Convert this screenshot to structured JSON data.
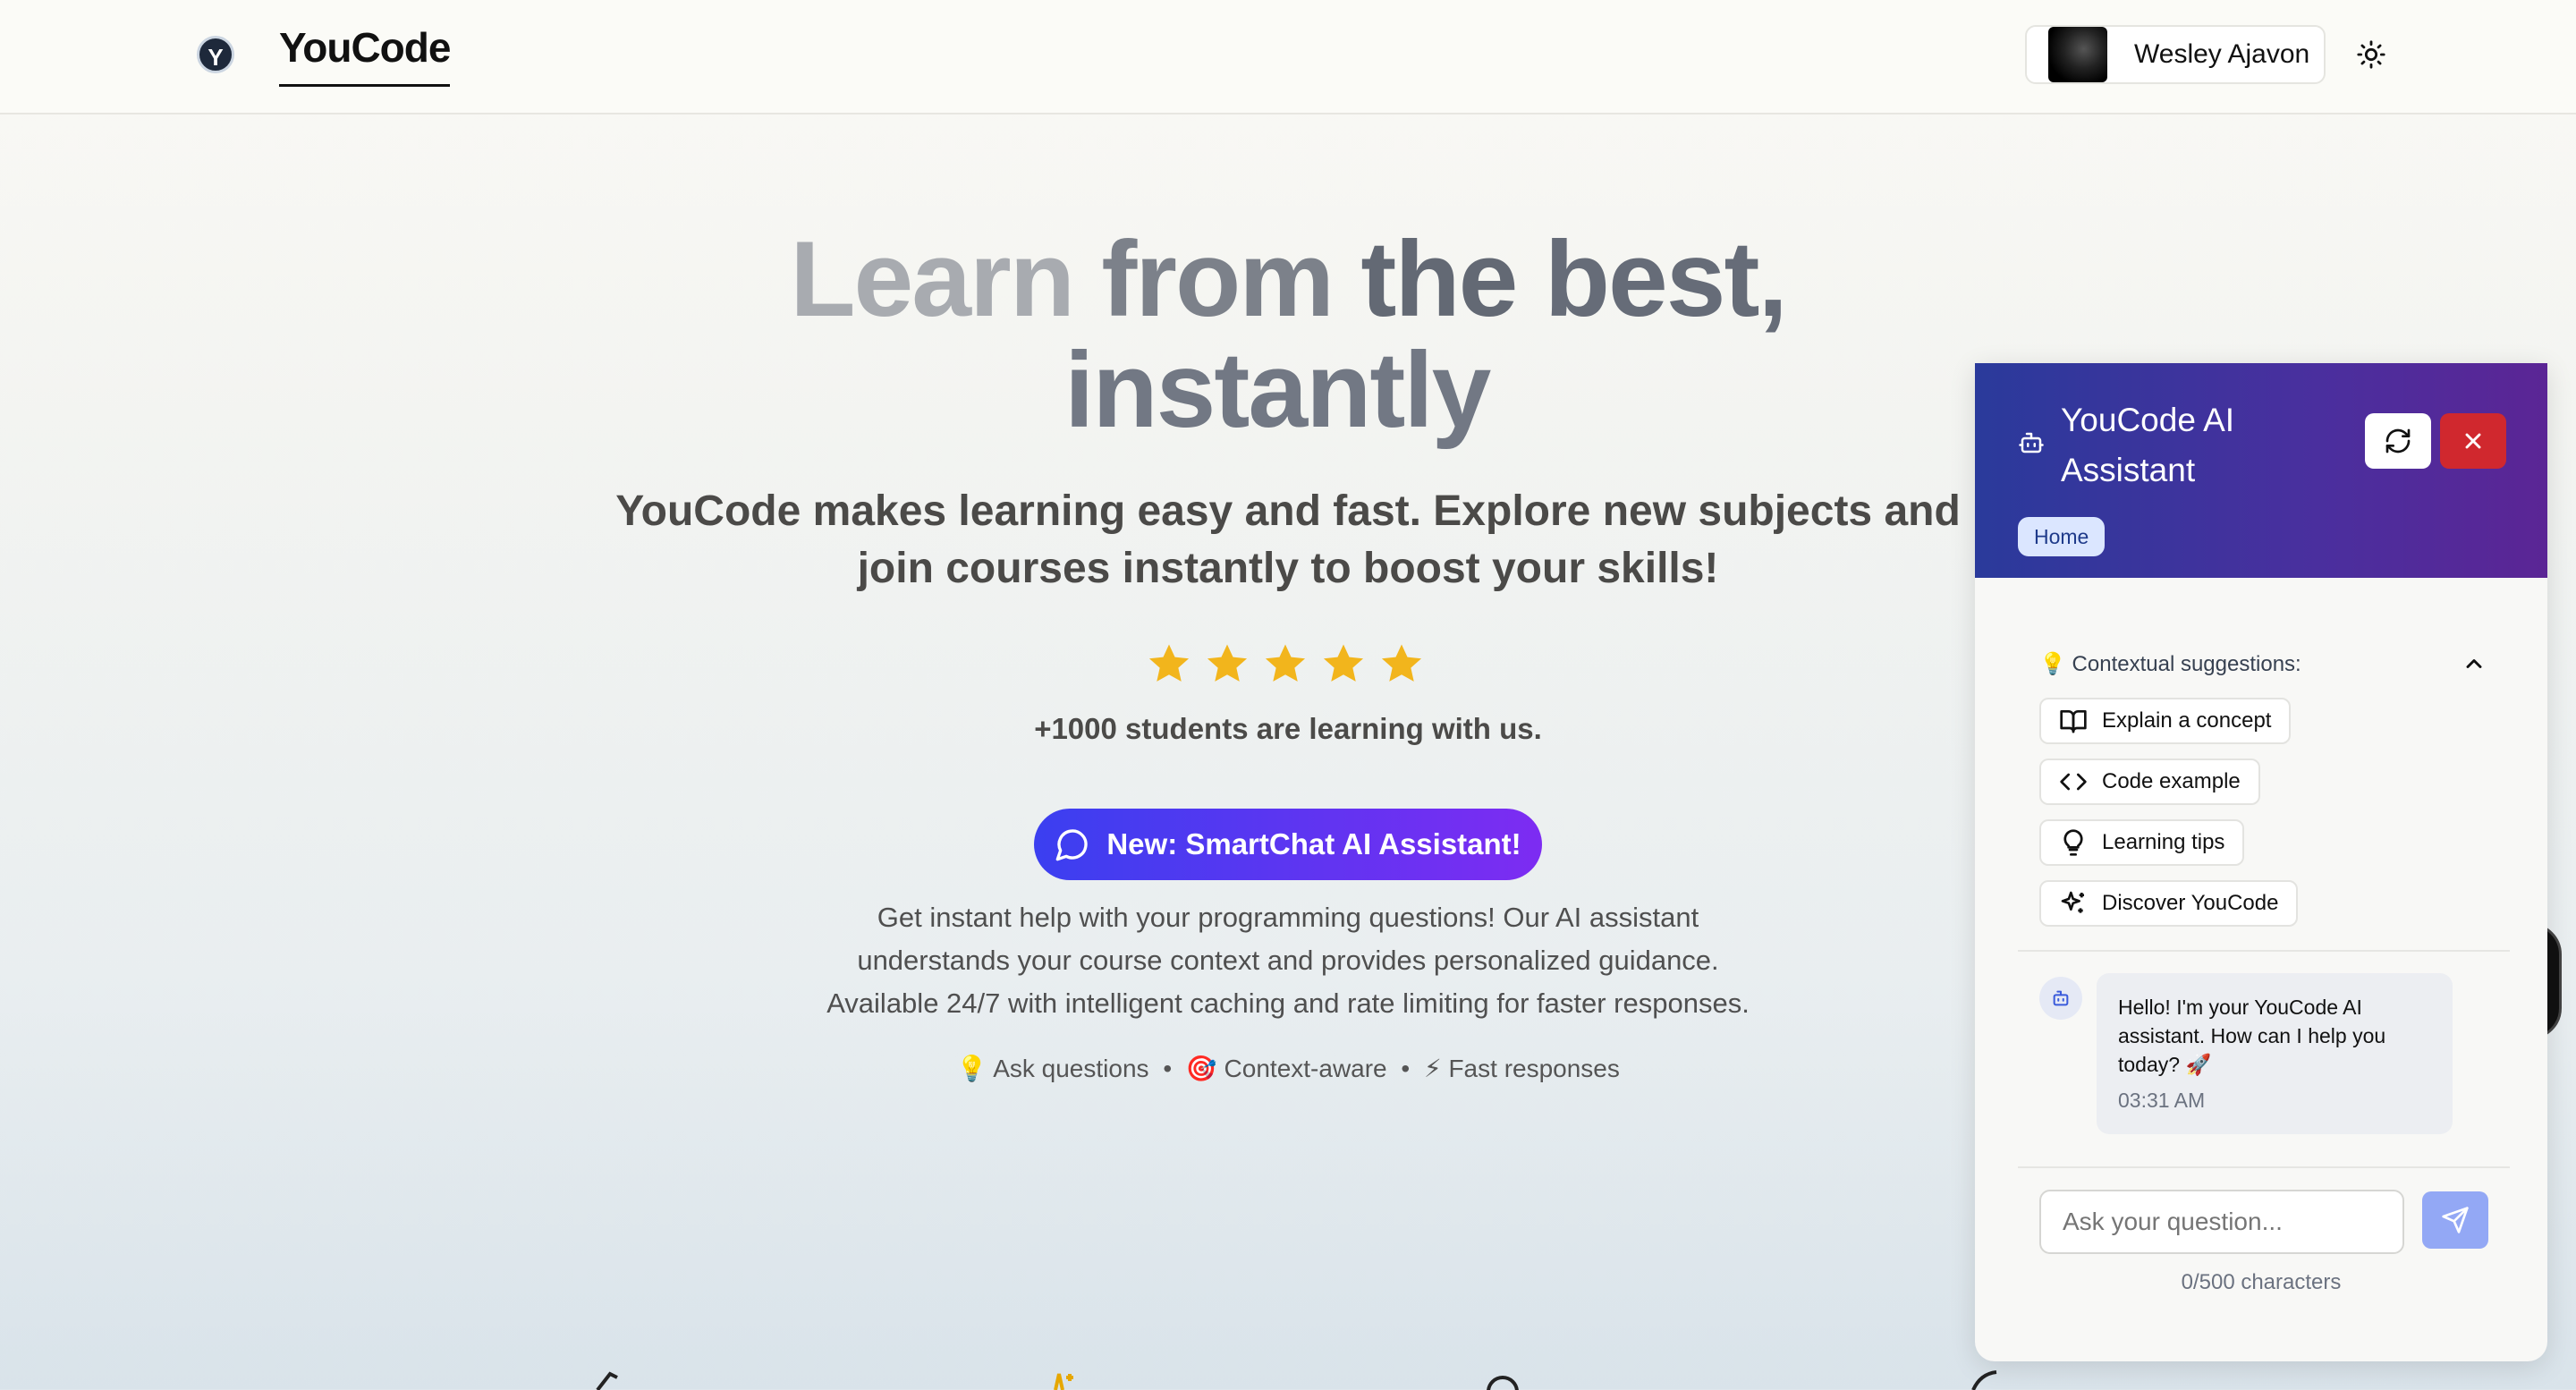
{
  "header": {
    "logo_letter": "Y",
    "brand": "YouCode",
    "user_name": "Wesley Ajavon"
  },
  "hero": {
    "title_words": [
      "Learn",
      "from",
      "the",
      "best,"
    ],
    "title_line2": "instantly",
    "subtitle": "YouCode makes learning easy and fast. Explore new subjects and join courses instantly to boost your skills!",
    "rating_stars": 5,
    "students": "+1000 students are learning with us.",
    "cta_label": "New: SmartChat AI Assistant!",
    "cta_description_lines": [
      "Get instant help with your programming questions! Our AI assistant",
      "understands your course context and provides personalized guidance.",
      "Available 24/7 with intelligent caching and rate limiting for faster responses."
    ],
    "features": [
      "💡 Ask questions",
      "•",
      "🎯 Context-aware",
      "•",
      "⚡ Fast responses"
    ]
  },
  "chat": {
    "title": "YouCode AI Assistant",
    "context_badge": "Home",
    "suggestions_header": "💡 Contextual suggestions:",
    "suggestions": [
      {
        "label": "Explain a concept",
        "icon": "book-open-icon"
      },
      {
        "label": "Code example",
        "icon": "code-icon"
      },
      {
        "label": "Learning tips",
        "icon": "lightbulb-icon"
      },
      {
        "label": "Discover YouCode",
        "icon": "sparkles-icon"
      }
    ],
    "message": {
      "text": "Hello! I'm your YouCode AI assistant. How can I help you today? 🚀",
      "time": "03:31 AM"
    },
    "input_placeholder": "Ask your question...",
    "counter": "0/500 characters"
  },
  "colors": {
    "accent_blue": "#3b3ff0",
    "accent_purple": "#7d2cf2",
    "star": "#f2b51c",
    "chat_header_start": "#2a3a9b",
    "chat_header_end": "#5b2595",
    "close_red": "#d0282e"
  }
}
